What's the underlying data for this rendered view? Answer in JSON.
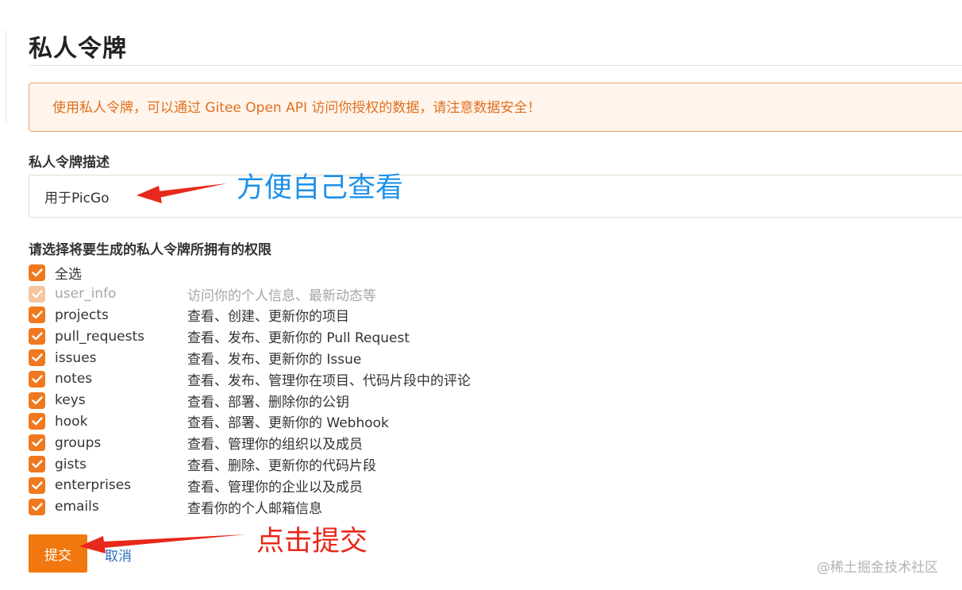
{
  "page": {
    "title": "私人令牌",
    "notice": "使用私人令牌，可以通过 Gitee Open API 访问你授权的数据，请注意数据安全！"
  },
  "form": {
    "description_label": "私人令牌描述",
    "description_value": "用于PicGo",
    "permissions_label": "请选择将要生成的私人令牌所拥有的权限",
    "submit_label": "提交",
    "cancel_label": "取消"
  },
  "permissions": [
    {
      "name": "全选",
      "desc": "",
      "checked": true,
      "disabled": false
    },
    {
      "name": "user_info",
      "desc": "访问你的个人信息、最新动态等",
      "checked": true,
      "disabled": true
    },
    {
      "name": "projects",
      "desc": "查看、创建、更新你的项目",
      "checked": true,
      "disabled": false
    },
    {
      "name": "pull_requests",
      "desc": "查看、发布、更新你的 Pull Request",
      "checked": true,
      "disabled": false
    },
    {
      "name": "issues",
      "desc": "查看、发布、更新你的 Issue",
      "checked": true,
      "disabled": false
    },
    {
      "name": "notes",
      "desc": "查看、发布、管理你在项目、代码片段中的评论",
      "checked": true,
      "disabled": false
    },
    {
      "name": "keys",
      "desc": "查看、部署、删除你的公钥",
      "checked": true,
      "disabled": false
    },
    {
      "name": "hook",
      "desc": "查看、部署、更新你的 Webhook",
      "checked": true,
      "disabled": false
    },
    {
      "name": "groups",
      "desc": "查看、管理你的组织以及成员",
      "checked": true,
      "disabled": false
    },
    {
      "name": "gists",
      "desc": "查看、删除、更新你的代码片段",
      "checked": true,
      "disabled": false
    },
    {
      "name": "enterprises",
      "desc": "查看、管理你的企业以及成员",
      "checked": true,
      "disabled": false
    },
    {
      "name": "emails",
      "desc": "查看你的个人邮箱信息",
      "checked": true,
      "disabled": false
    }
  ],
  "annotations": {
    "description_note": "方便自己查看",
    "submit_note": "点击提交"
  },
  "watermark": "@稀土掘金技术社区",
  "colors": {
    "accent": "#f0780f",
    "checkbox": "#f0781e",
    "checkbox_disabled": "#f5c6a0",
    "notice_text": "#e0701f",
    "notice_bg": "#fff5ec",
    "link": "#2a6ebb",
    "annotation_blue": "#1e90e8",
    "annotation_red": "#e8281a"
  },
  "icons": {
    "checkbox": "check-icon",
    "arrow": "arrow-icon"
  }
}
